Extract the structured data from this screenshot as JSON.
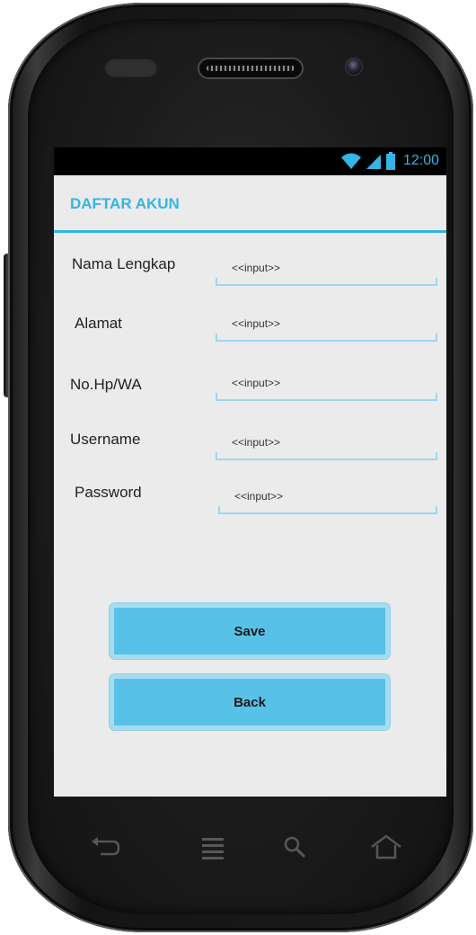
{
  "status_bar": {
    "time": "12:00",
    "icons": [
      "wifi-icon",
      "signal-icon",
      "battery-icon"
    ]
  },
  "action_bar": {
    "title": "DAFTAR AKUN"
  },
  "form": {
    "fields": [
      {
        "label": "Nama Lengkap",
        "placeholder": "<<input>>"
      },
      {
        "label": "Alamat",
        "placeholder": "<<input>>"
      },
      {
        "label": "No.Hp/WA",
        "placeholder": "<<input>>"
      },
      {
        "label": "Username",
        "placeholder": "<<input>>"
      },
      {
        "label": "Password",
        "placeholder": "<<input>>"
      }
    ]
  },
  "buttons": {
    "save_label": "Save",
    "back_label": "Back"
  },
  "nav_bar": {
    "icons": [
      "back-icon",
      "menu-icon",
      "search-icon",
      "home-icon"
    ]
  },
  "colors": {
    "accent": "#33b5e5",
    "button_fill": "#57c1e8",
    "screen_bg": "#ebebeb"
  }
}
